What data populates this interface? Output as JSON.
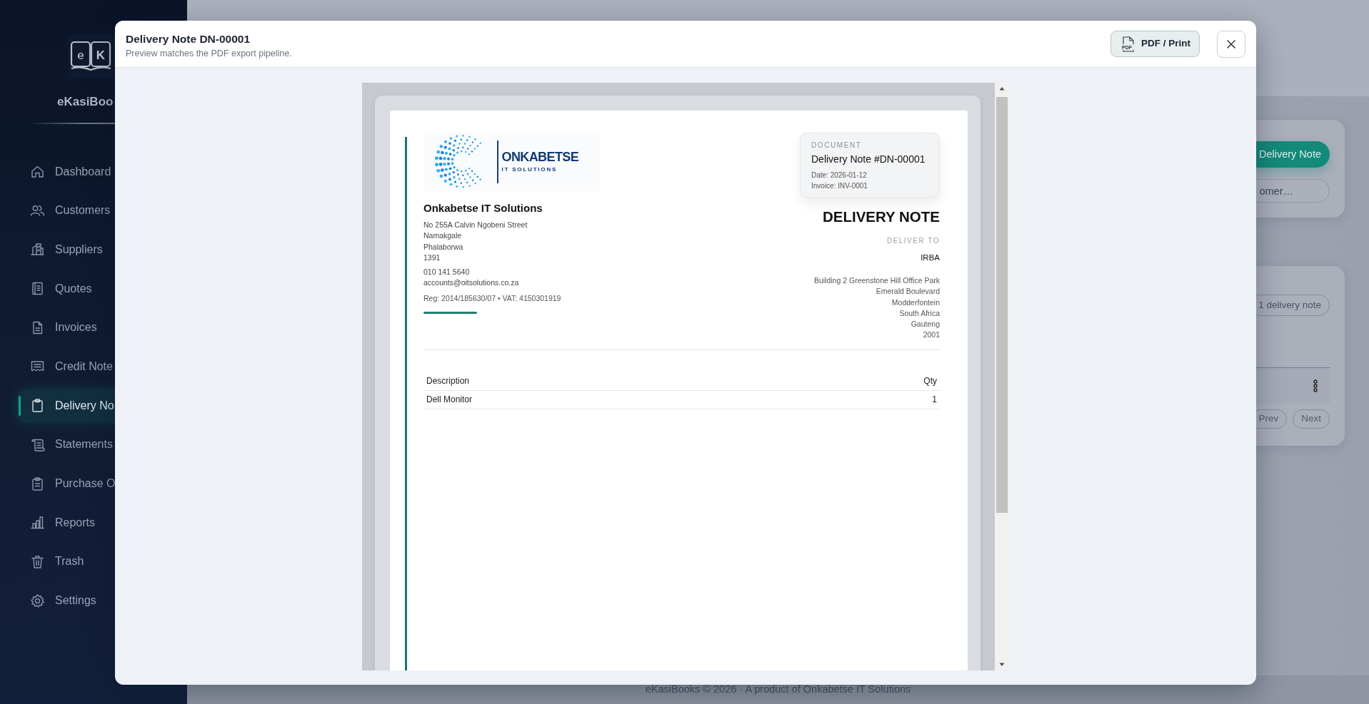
{
  "sidebar": {
    "logo_letters": [
      "e",
      "K"
    ],
    "brand": "eKasiBoo",
    "items": [
      {
        "label": "Dashboard",
        "selected": false
      },
      {
        "label": "Customers",
        "selected": false
      },
      {
        "label": "Suppliers",
        "selected": false
      },
      {
        "label": "Quotes",
        "selected": false
      },
      {
        "label": "Invoices",
        "selected": false
      },
      {
        "label": "Credit Note",
        "selected": false
      },
      {
        "label": "Delivery No",
        "selected": true
      },
      {
        "label": "Statements",
        "selected": false
      },
      {
        "label": "Purchase O",
        "selected": false
      },
      {
        "label": "Reports",
        "selected": false
      },
      {
        "label": "Trash",
        "selected": false
      },
      {
        "label": "Settings",
        "selected": false
      }
    ]
  },
  "page": {
    "new_button": "Delivery Note",
    "search": {
      "placeholder": "omer…"
    },
    "count_badge": "1 delivery note",
    "pagination": [
      "Prev",
      "Next"
    ]
  },
  "modal": {
    "title": "Delivery Note DN-00001",
    "subtitle": "Preview matches the PDF export pipeline.",
    "pdf_button": {
      "label": "PDF / Print",
      "icon_label": "PDF"
    },
    "document": {
      "logo": {
        "name": "ONKABETSE",
        "tagline": "IT SOLUTIONS"
      },
      "company": {
        "name": "Onkabetse IT Solutions",
        "address": [
          "No 255A Calvin Ngobeni Street",
          "Namakgale",
          "Phalaborwa",
          "1391"
        ],
        "phone": "010 141 5640",
        "email": "accounts@oitsolutions.co.za",
        "registration": "Reg: 2014/185630/07 • VAT: 4150301919"
      },
      "info_card": {
        "label": "DOCUMENT",
        "title": "Delivery Note #DN-00001",
        "lines": [
          "Date: 2026-01-12",
          "Invoice: INV-0001"
        ]
      },
      "heading": "DELIVERY NOTE",
      "deliver_to": {
        "label": "DELIVER TO",
        "name": "IRBA",
        "address": [
          "Building 2 Greenstone Hill Office Park",
          "Emerald Boulevard",
          "Modderfontein",
          "South Africa",
          "Gauteng",
          "2001"
        ]
      },
      "table": {
        "columns": [
          "Description",
          "Qty"
        ],
        "rows": [
          [
            "Dell Monitor",
            "1"
          ]
        ]
      }
    }
  },
  "footer": "eKasiBooks © 2026 · A product of Onkabetse IT Solutions"
}
